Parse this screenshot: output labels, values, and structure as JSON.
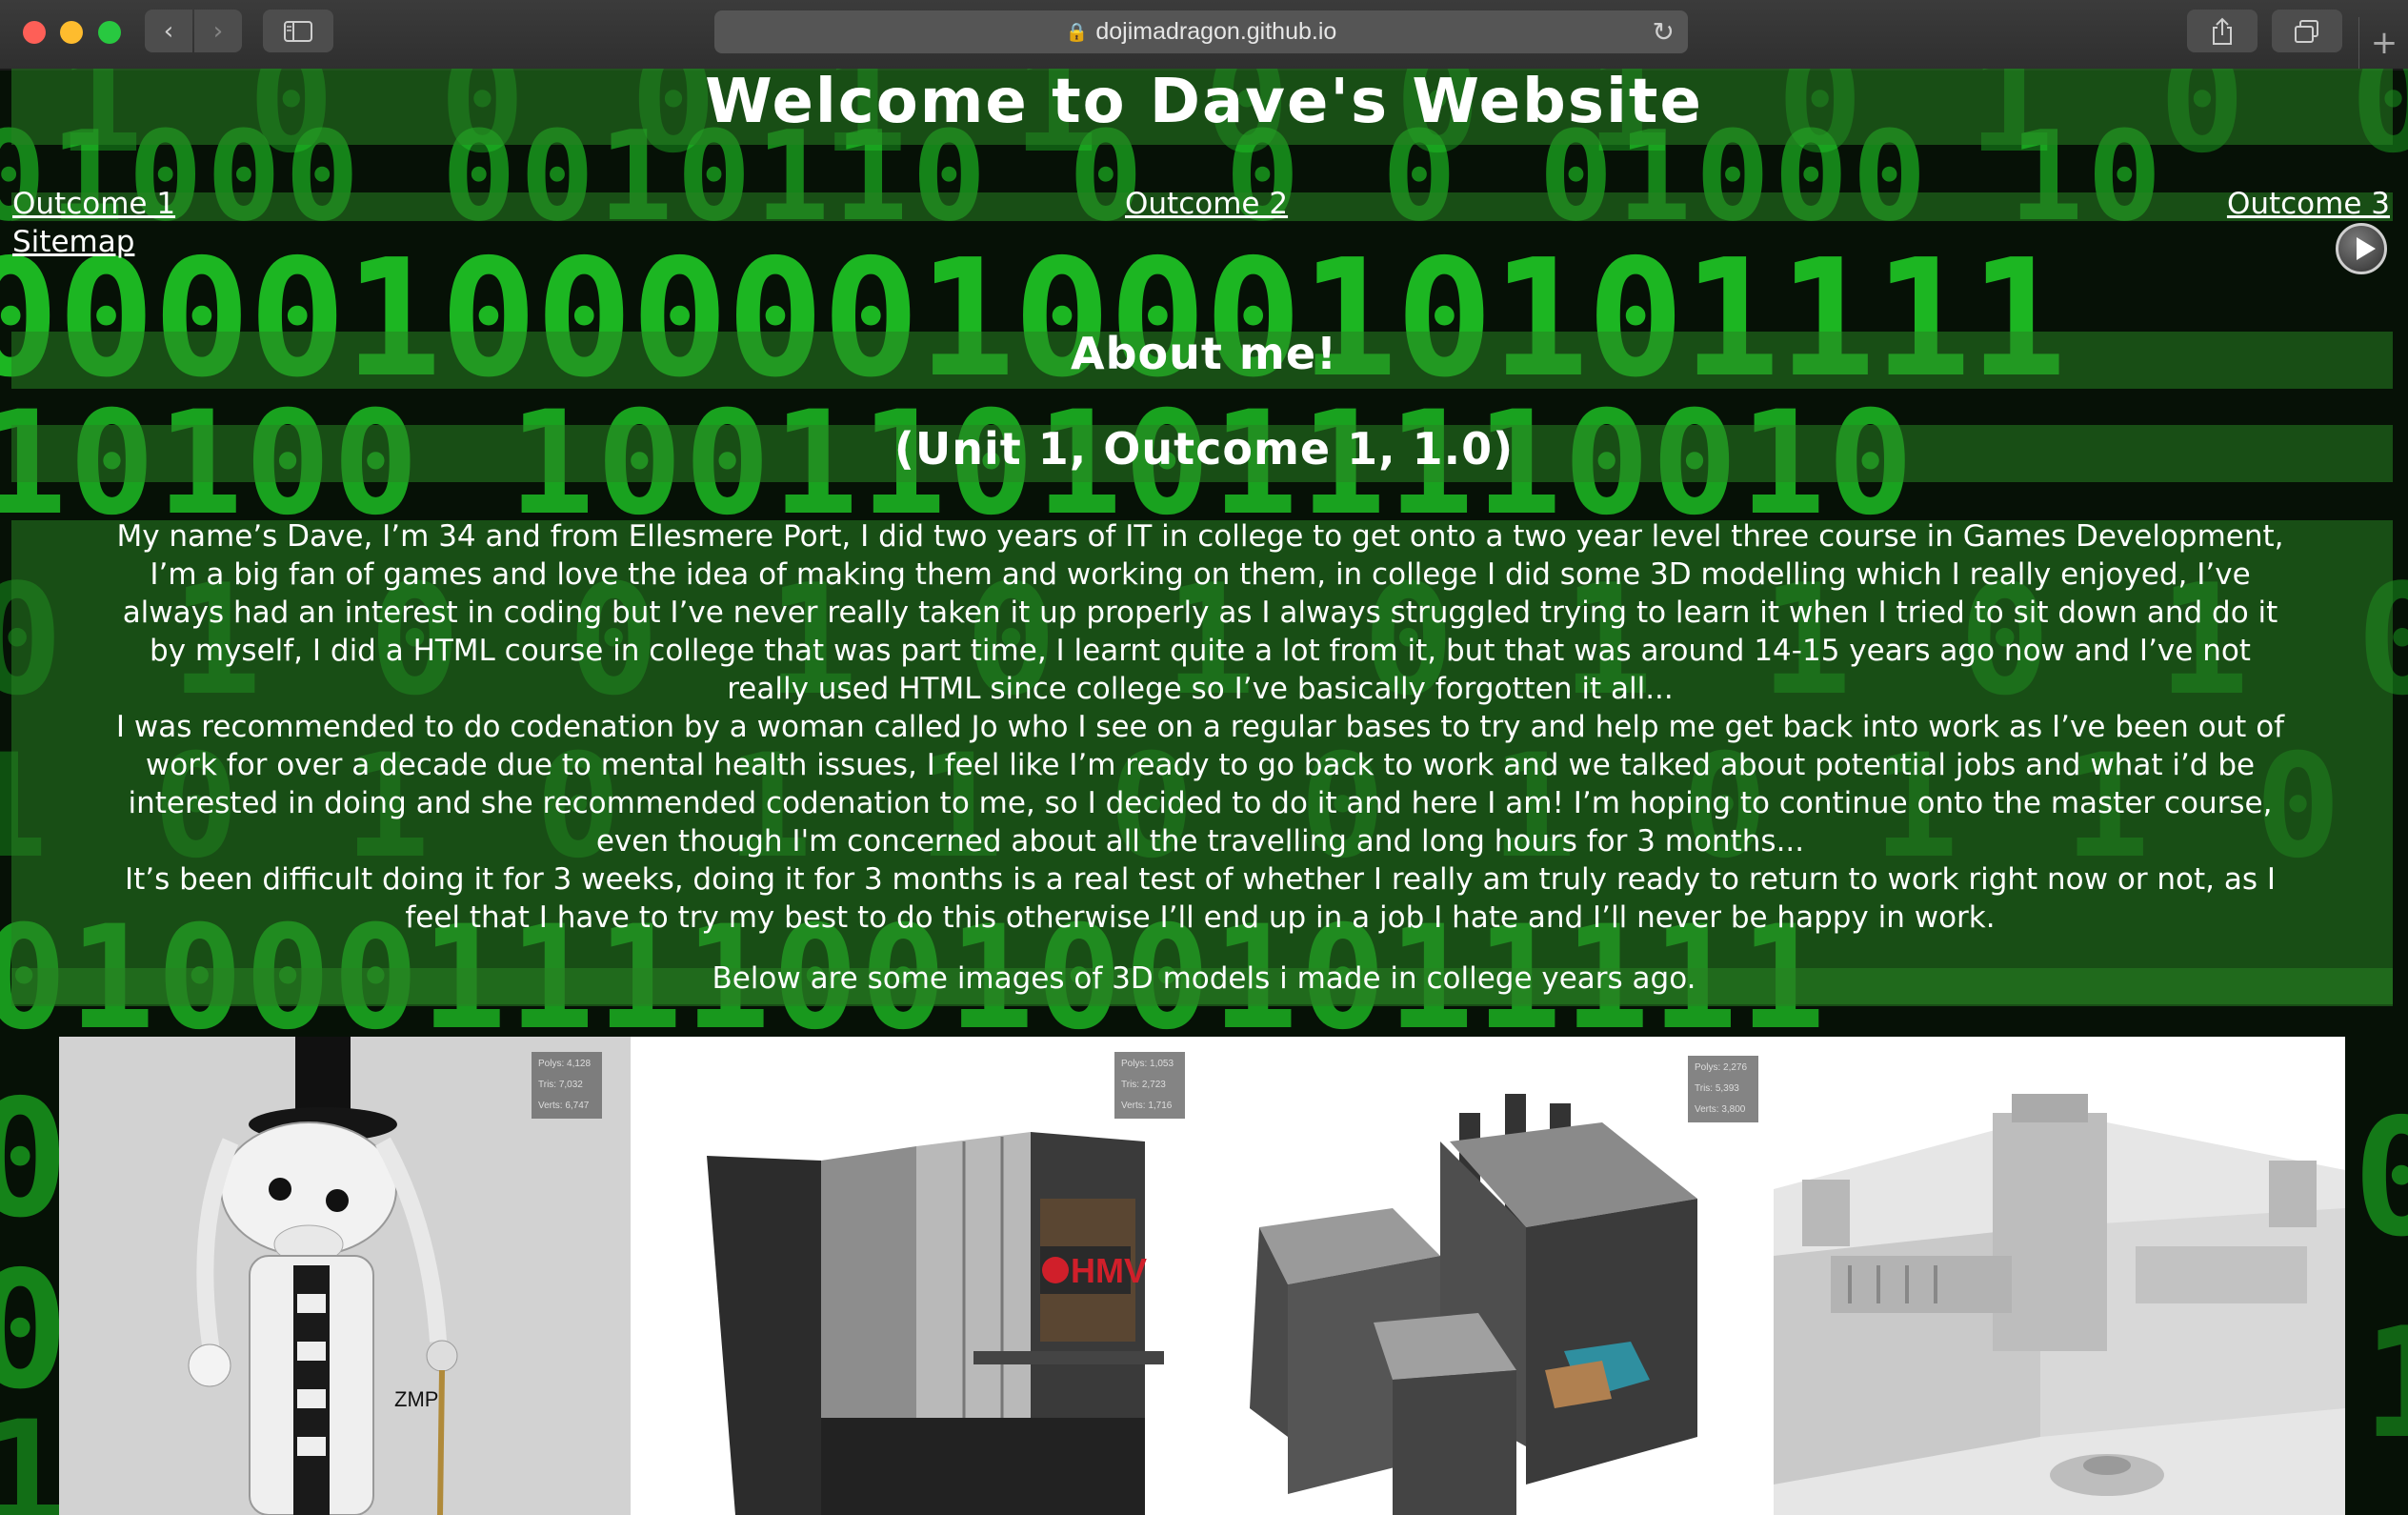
{
  "browser": {
    "url": "dojimadragon.github.io",
    "back_glyph": "‹",
    "forward_glyph": "›",
    "new_tab_glyph": "+",
    "reload_glyph": "↻"
  },
  "site": {
    "title": "Welcome to Dave's Website",
    "nav": {
      "outcome1": "Outcome 1",
      "outcome2": "Outcome 2",
      "outcome3": "Outcome 3",
      "sitemap": "Sitemap"
    },
    "heading": "About me!",
    "subheading": "(Unit 1, Outcome 1, 1.0)",
    "paragraphs": [
      "My name’s Dave, I’m 34 and from Ellesmere Port, I did two years of IT in college to get onto a two year level three course in Games Development, I’m a big fan of games and love the idea of making them and working on them, in college I did some 3D modelling which I really enjoyed, I’ve always had an interest in coding but I’ve never really taken it up properly as I always struggled trying to learn it when I tried to sit down and do it by myself, I did a HTML course in college that was part time, I learnt quite a lot from it, but that was around 14-15 years ago now and I’ve not really used HTML since college so I’ve basically forgotten it all...",
      "I was recommended to do codenation by a woman called Jo who I see on a regular bases to try and help me get back into work as I’ve been out of work for over a decade due to mental health issues, I feel like I’m ready to go back to work and we talked about potential jobs and what i’d be interested in doing and she recommended codenation to me, so I decided to do it and here I am! I’m hoping to continue onto the master course, even though I'm concerned about all the travelling and long hours for 3 months...",
      "It’s been difficult doing it for 3 weeks, doing it for 3 months is a real test of whether I really am truly ready to return to work right now or not, as I feel that I have to try my best to do this otherwise I’ll end up in a job I hate and I’ll never be happy in work."
    ],
    "gallery_caption": "Below are some images of 3D models i made in college years ago.",
    "gallery": [
      {
        "name": "robot",
        "stats": [
          "Polys: 4,128",
          "Tris: 7,032",
          "Verts: 6,747"
        ],
        "label": "ZMP"
      },
      {
        "name": "hmv-building",
        "stats": [
          "Polys: 1,053",
          "Tris: 2,723",
          "Verts: 1,716"
        ],
        "label": "HMV"
      },
      {
        "name": "factory",
        "stats": [
          "Polys: 2,276",
          "Tris: 5,393",
          "Verts: 3,800"
        ]
      },
      {
        "name": "mansion"
      }
    ]
  },
  "colors": {
    "matrix_green": "#22e02a",
    "band_green": "#2f8a28",
    "background": "#061106"
  }
}
